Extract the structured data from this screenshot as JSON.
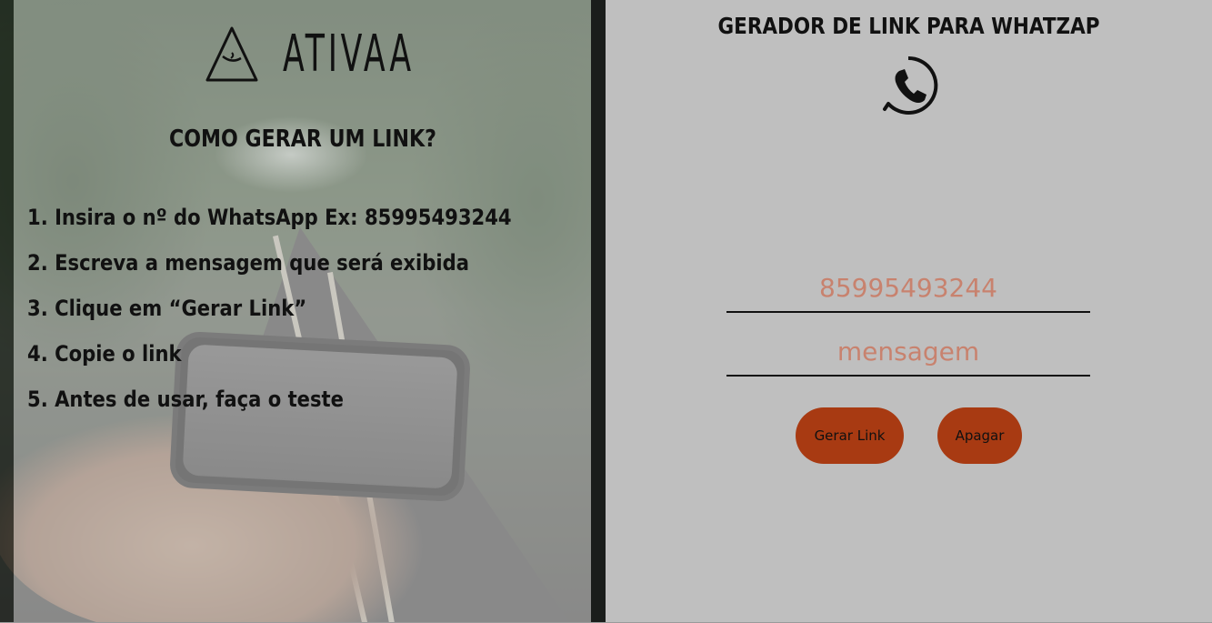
{
  "left": {
    "logo_text": "ATIVAA",
    "how_title": "COMO GERAR UM LINK?",
    "steps": [
      "1. Insira o nº do WhatsApp Ex: 85995493244",
      "2. Escreva a mensagem que será exibida",
      "3. Clique em   “Gerar Link”",
      "4. Copie o link",
      "5. Antes de usar, faça o teste"
    ]
  },
  "right": {
    "title": "GERADOR DE LINK PARA WHATZAP",
    "phone_placeholder": "85995493244",
    "message_placeholder": "mensagem",
    "generate_label": "Gerar Link",
    "clear_label": "Apagar"
  },
  "colors": {
    "button": "#a83a12",
    "placeholder": "#c8826e",
    "panel": "#bfbfbf"
  },
  "icons": [
    "logo-triangle-icon",
    "phone-icon"
  ]
}
